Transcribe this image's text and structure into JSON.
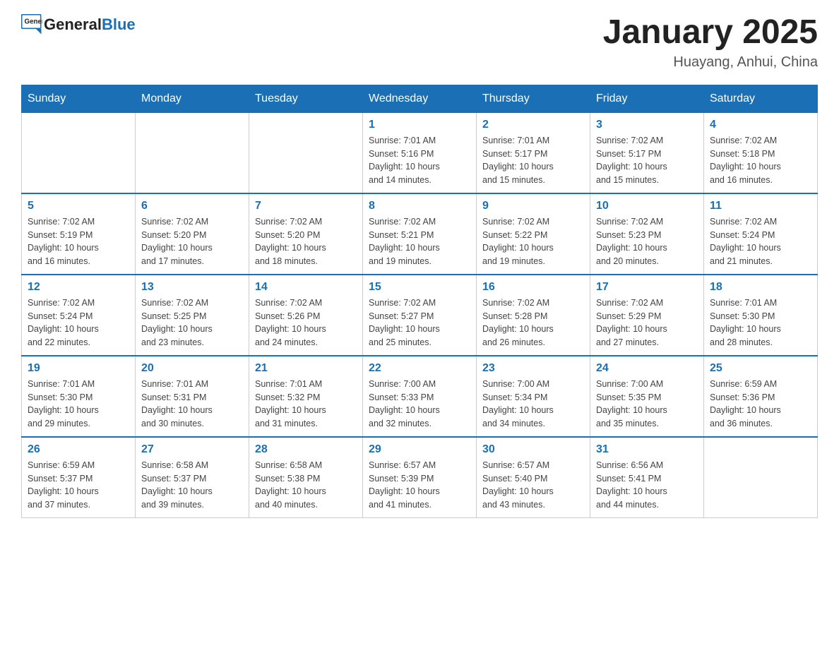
{
  "header": {
    "logo_general": "General",
    "logo_blue": "Blue",
    "month_title": "January 2025",
    "location": "Huayang, Anhui, China"
  },
  "days_of_week": [
    "Sunday",
    "Monday",
    "Tuesday",
    "Wednesday",
    "Thursday",
    "Friday",
    "Saturday"
  ],
  "weeks": [
    [
      {
        "day": "",
        "info": ""
      },
      {
        "day": "",
        "info": ""
      },
      {
        "day": "",
        "info": ""
      },
      {
        "day": "1",
        "info": "Sunrise: 7:01 AM\nSunset: 5:16 PM\nDaylight: 10 hours\nand 14 minutes."
      },
      {
        "day": "2",
        "info": "Sunrise: 7:01 AM\nSunset: 5:17 PM\nDaylight: 10 hours\nand 15 minutes."
      },
      {
        "day": "3",
        "info": "Sunrise: 7:02 AM\nSunset: 5:17 PM\nDaylight: 10 hours\nand 15 minutes."
      },
      {
        "day": "4",
        "info": "Sunrise: 7:02 AM\nSunset: 5:18 PM\nDaylight: 10 hours\nand 16 minutes."
      }
    ],
    [
      {
        "day": "5",
        "info": "Sunrise: 7:02 AM\nSunset: 5:19 PM\nDaylight: 10 hours\nand 16 minutes."
      },
      {
        "day": "6",
        "info": "Sunrise: 7:02 AM\nSunset: 5:20 PM\nDaylight: 10 hours\nand 17 minutes."
      },
      {
        "day": "7",
        "info": "Sunrise: 7:02 AM\nSunset: 5:20 PM\nDaylight: 10 hours\nand 18 minutes."
      },
      {
        "day": "8",
        "info": "Sunrise: 7:02 AM\nSunset: 5:21 PM\nDaylight: 10 hours\nand 19 minutes."
      },
      {
        "day": "9",
        "info": "Sunrise: 7:02 AM\nSunset: 5:22 PM\nDaylight: 10 hours\nand 19 minutes."
      },
      {
        "day": "10",
        "info": "Sunrise: 7:02 AM\nSunset: 5:23 PM\nDaylight: 10 hours\nand 20 minutes."
      },
      {
        "day": "11",
        "info": "Sunrise: 7:02 AM\nSunset: 5:24 PM\nDaylight: 10 hours\nand 21 minutes."
      }
    ],
    [
      {
        "day": "12",
        "info": "Sunrise: 7:02 AM\nSunset: 5:24 PM\nDaylight: 10 hours\nand 22 minutes."
      },
      {
        "day": "13",
        "info": "Sunrise: 7:02 AM\nSunset: 5:25 PM\nDaylight: 10 hours\nand 23 minutes."
      },
      {
        "day": "14",
        "info": "Sunrise: 7:02 AM\nSunset: 5:26 PM\nDaylight: 10 hours\nand 24 minutes."
      },
      {
        "day": "15",
        "info": "Sunrise: 7:02 AM\nSunset: 5:27 PM\nDaylight: 10 hours\nand 25 minutes."
      },
      {
        "day": "16",
        "info": "Sunrise: 7:02 AM\nSunset: 5:28 PM\nDaylight: 10 hours\nand 26 minutes."
      },
      {
        "day": "17",
        "info": "Sunrise: 7:02 AM\nSunset: 5:29 PM\nDaylight: 10 hours\nand 27 minutes."
      },
      {
        "day": "18",
        "info": "Sunrise: 7:01 AM\nSunset: 5:30 PM\nDaylight: 10 hours\nand 28 minutes."
      }
    ],
    [
      {
        "day": "19",
        "info": "Sunrise: 7:01 AM\nSunset: 5:30 PM\nDaylight: 10 hours\nand 29 minutes."
      },
      {
        "day": "20",
        "info": "Sunrise: 7:01 AM\nSunset: 5:31 PM\nDaylight: 10 hours\nand 30 minutes."
      },
      {
        "day": "21",
        "info": "Sunrise: 7:01 AM\nSunset: 5:32 PM\nDaylight: 10 hours\nand 31 minutes."
      },
      {
        "day": "22",
        "info": "Sunrise: 7:00 AM\nSunset: 5:33 PM\nDaylight: 10 hours\nand 32 minutes."
      },
      {
        "day": "23",
        "info": "Sunrise: 7:00 AM\nSunset: 5:34 PM\nDaylight: 10 hours\nand 34 minutes."
      },
      {
        "day": "24",
        "info": "Sunrise: 7:00 AM\nSunset: 5:35 PM\nDaylight: 10 hours\nand 35 minutes."
      },
      {
        "day": "25",
        "info": "Sunrise: 6:59 AM\nSunset: 5:36 PM\nDaylight: 10 hours\nand 36 minutes."
      }
    ],
    [
      {
        "day": "26",
        "info": "Sunrise: 6:59 AM\nSunset: 5:37 PM\nDaylight: 10 hours\nand 37 minutes."
      },
      {
        "day": "27",
        "info": "Sunrise: 6:58 AM\nSunset: 5:37 PM\nDaylight: 10 hours\nand 39 minutes."
      },
      {
        "day": "28",
        "info": "Sunrise: 6:58 AM\nSunset: 5:38 PM\nDaylight: 10 hours\nand 40 minutes."
      },
      {
        "day": "29",
        "info": "Sunrise: 6:57 AM\nSunset: 5:39 PM\nDaylight: 10 hours\nand 41 minutes."
      },
      {
        "day": "30",
        "info": "Sunrise: 6:57 AM\nSunset: 5:40 PM\nDaylight: 10 hours\nand 43 minutes."
      },
      {
        "day": "31",
        "info": "Sunrise: 6:56 AM\nSunset: 5:41 PM\nDaylight: 10 hours\nand 44 minutes."
      },
      {
        "day": "",
        "info": ""
      }
    ]
  ]
}
